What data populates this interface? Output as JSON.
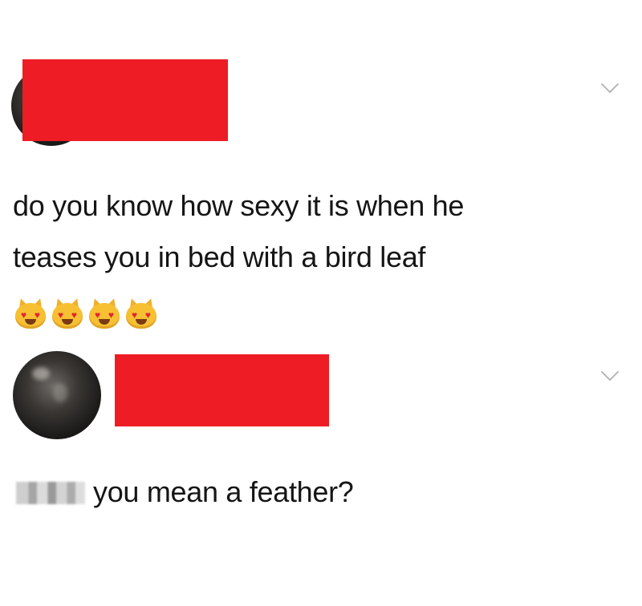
{
  "posts": [
    {
      "text_line1": "do you know how sexy it is when he",
      "text_line2": "teases you in bed with a bird leaf",
      "emoji": [
        "smiling-cat-heart-eyes",
        "smiling-cat-heart-eyes",
        "smiling-cat-heart-eyes",
        "smiling-cat-heart-eyes"
      ]
    },
    {
      "text": "you mean a feather?"
    }
  ],
  "colors": {
    "redaction": "#ee1c25",
    "chevron": "#b8b8b8",
    "text": "#151515"
  }
}
